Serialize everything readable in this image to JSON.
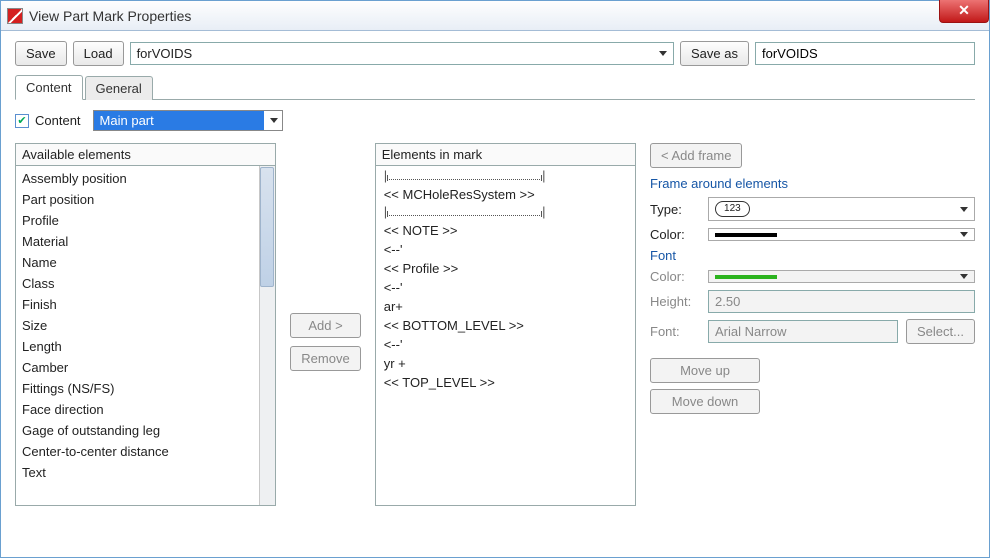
{
  "window": {
    "title": "View Part Mark Properties"
  },
  "toolbar": {
    "save_label": "Save",
    "load_label": "Load",
    "preset_value": "forVOIDS",
    "save_as_label": "Save as",
    "save_as_value": "forVOIDS"
  },
  "tabs": {
    "content": "Content",
    "general": "General"
  },
  "content": {
    "checkbox_label": "Content",
    "mainpart_value": "Main part"
  },
  "available": {
    "header": "Available elements",
    "items": [
      "Assembly position",
      "Part position",
      "Profile",
      "Material",
      "Name",
      "Class",
      "Finish",
      "Size",
      "Length",
      "Camber",
      "Fittings (NS/FS)",
      "Face direction",
      "Gage of outstanding leg",
      "Center-to-center distance",
      "Text"
    ]
  },
  "buttons": {
    "add": "Add >",
    "remove": "Remove"
  },
  "mark": {
    "header": "Elements in mark",
    "items": [
      {
        "t": "sep"
      },
      {
        "t": "txt",
        "v": "<< MCHoleResSystem >>"
      },
      {
        "t": "sep"
      },
      {
        "t": "txt",
        "v": "<< NOTE >>"
      },
      {
        "t": "txt",
        "v": "<--'"
      },
      {
        "t": "txt",
        "v": "<< Profile >>"
      },
      {
        "t": "txt",
        "v": "<--'"
      },
      {
        "t": "txt",
        "v": "ar+"
      },
      {
        "t": "txt",
        "v": "<< BOTTOM_LEVEL >>"
      },
      {
        "t": "txt",
        "v": "<--'"
      },
      {
        "t": "txt",
        "v": "yr +"
      },
      {
        "t": "txt",
        "v": "<< TOP_LEVEL >>"
      }
    ]
  },
  "frame": {
    "add_frame_btn": "< Add frame",
    "section_frame": "Frame around elements",
    "type_label": "Type:",
    "type_value": "123",
    "color_label": "Color:",
    "section_font": "Font",
    "font_color_label": "Color:",
    "height_label": "Height:",
    "height_value": "2.50",
    "font_label": "Font:",
    "font_value": "Arial Narrow",
    "select_btn": "Select...",
    "move_up": "Move up",
    "move_down": "Move down"
  }
}
